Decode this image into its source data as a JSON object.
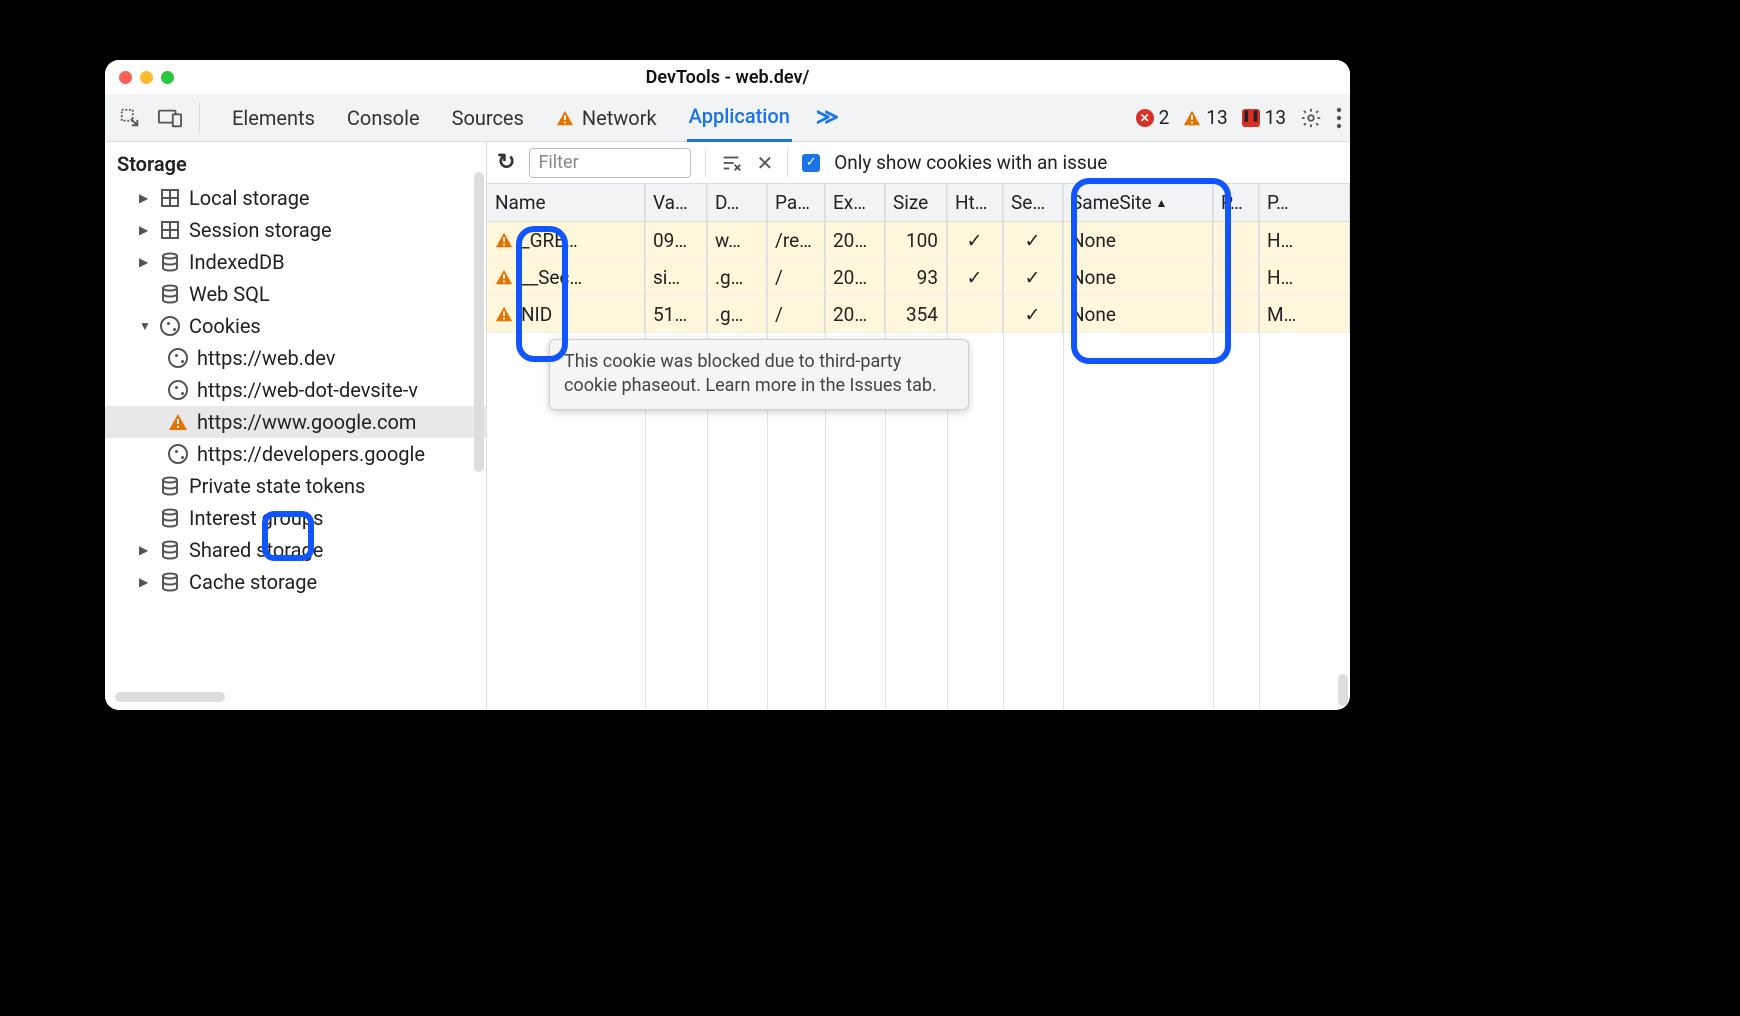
{
  "window": {
    "title": "DevTools - web.dev/"
  },
  "tabs": {
    "elements": "Elements",
    "console": "Console",
    "sources": "Sources",
    "network": "Network",
    "application": "Application",
    "more": "≫"
  },
  "counters": {
    "errors": "2",
    "warnings": "13",
    "issues": "13"
  },
  "sidebar": {
    "section": "Storage",
    "items": [
      {
        "label": "Local storage",
        "icon": "grid",
        "expandable": true,
        "expanded": false
      },
      {
        "label": "Session storage",
        "icon": "grid",
        "expandable": true,
        "expanded": false
      },
      {
        "label": "IndexedDB",
        "icon": "db",
        "expandable": true,
        "expanded": false
      },
      {
        "label": "Web SQL",
        "icon": "db",
        "expandable": false,
        "expanded": false
      },
      {
        "label": "Cookies",
        "icon": "cookie",
        "expandable": true,
        "expanded": true
      },
      {
        "label": "Private state tokens",
        "icon": "db",
        "expandable": false
      },
      {
        "label": "Interest groups",
        "icon": "db",
        "expandable": false
      },
      {
        "label": "Shared storage",
        "icon": "db",
        "expandable": true,
        "expanded": false
      },
      {
        "label": "Cache storage",
        "icon": "db",
        "expandable": true,
        "expanded": false
      }
    ],
    "cookies_children": [
      {
        "label": "https://web.dev",
        "icon": "cookie",
        "warn": false,
        "selected": false
      },
      {
        "label": "https://web-dot-devsite-v",
        "icon": "cookie",
        "warn": false,
        "selected": false
      },
      {
        "label": "https://www.google.com",
        "icon": "warn",
        "warn": true,
        "selected": true
      },
      {
        "label": "https://developers.google",
        "icon": "cookie",
        "warn": false,
        "selected": false
      }
    ]
  },
  "toolbar": {
    "filter_placeholder": "Filter",
    "only_issues_label": "Only show cookies with an issue"
  },
  "columns": {
    "name": "Name",
    "value": "Va…",
    "domain": "D…",
    "path": "Pa…",
    "expires": "Ex…",
    "size": "Size",
    "http": "Ht…",
    "secure": "Se…",
    "samesite": "SameSite",
    "p1": "P…",
    "p2": "P…"
  },
  "rows": [
    {
      "name": "_GRE…",
      "value": "09…",
      "domain": "w…",
      "path": "/re…",
      "expires": "20…",
      "size": "100",
      "http": "✓",
      "secure": "✓",
      "samesite": "None",
      "p1": "",
      "p2": "H…"
    },
    {
      "name": "__Sec…",
      "value": "si…",
      "domain": ".g…",
      "path": "/",
      "expires": "20…",
      "size": "93",
      "http": "✓",
      "secure": "✓",
      "samesite": "None",
      "p1": "",
      "p2": "H…"
    },
    {
      "name": "NID",
      "value": "51…",
      "domain": ".g…",
      "path": "/",
      "expires": "20…",
      "size": "354",
      "http": "",
      "secure": "✓",
      "samesite": "None",
      "p1": "",
      "p2": "M…"
    }
  ],
  "tooltip": {
    "text": "This cookie was blocked due to third-party cookie phaseout. Learn more in the Issues tab."
  }
}
